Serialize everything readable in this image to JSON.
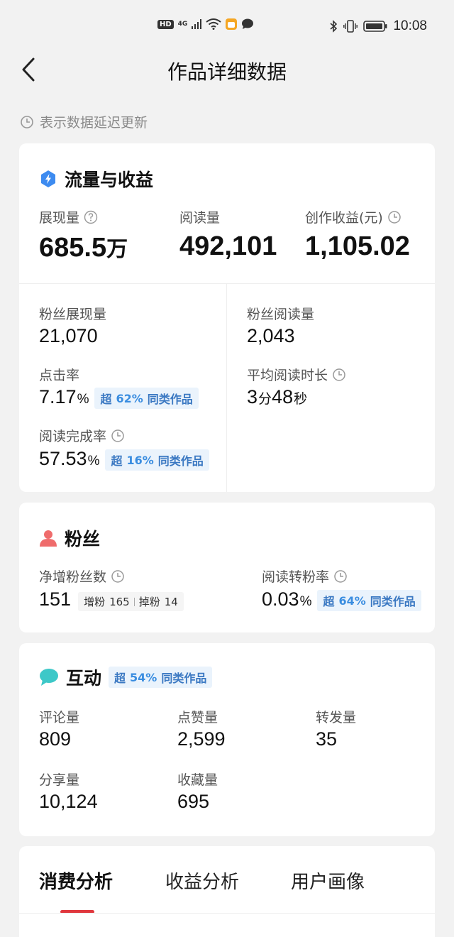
{
  "status_bar": {
    "hd": "HD",
    "network": "4G",
    "time": "10:08"
  },
  "header": {
    "title": "作品详细数据"
  },
  "notice": {
    "text": "表示数据延迟更新"
  },
  "traffic": {
    "title": "流量与收益",
    "impressions": {
      "label": "展现量",
      "value": "685.5",
      "unit": "万"
    },
    "reads": {
      "label": "阅读量",
      "value": "492,101"
    },
    "earnings": {
      "label": "创作收益(元)",
      "value": "1,105.02"
    },
    "fan_impressions": {
      "label": "粉丝展现量",
      "value": "21,070"
    },
    "fan_reads": {
      "label": "粉丝阅读量",
      "value": "2,043"
    },
    "ctr": {
      "label": "点击率",
      "value": "7.17",
      "unit": "%",
      "badge_prefix": "超",
      "badge_pct": "62%",
      "badge_suffix": "同类作品"
    },
    "avg_read_time": {
      "label": "平均阅读时长",
      "minutes": "3",
      "min_unit": "分",
      "seconds": "48",
      "sec_unit": "秒"
    },
    "completion": {
      "label": "阅读完成率",
      "value": "57.53",
      "unit": "%",
      "badge_prefix": "超",
      "badge_pct": "16%",
      "badge_suffix": "同类作品"
    }
  },
  "fans": {
    "title": "粉丝",
    "net_gain": {
      "label": "净增粉丝数",
      "value": "151",
      "gain_label": "增粉",
      "gain": "165",
      "loss_label": "掉粉",
      "loss": "14"
    },
    "conversion": {
      "label": "阅读转粉率",
      "value": "0.03",
      "unit": "%",
      "badge_prefix": "超",
      "badge_pct": "64%",
      "badge_suffix": "同类作品"
    }
  },
  "interaction": {
    "title": "互动",
    "badge_prefix": "超",
    "badge_pct": "54%",
    "badge_suffix": "同类作品",
    "comments": {
      "label": "评论量",
      "value": "809"
    },
    "likes": {
      "label": "点赞量",
      "value": "2,599"
    },
    "reposts": {
      "label": "转发量",
      "value": "35"
    },
    "shares": {
      "label": "分享量",
      "value": "10,124"
    },
    "favorites": {
      "label": "收藏量",
      "value": "695"
    }
  },
  "tabs": [
    {
      "label": "消费分析"
    },
    {
      "label": "收益分析"
    },
    {
      "label": "用户画像"
    }
  ],
  "colors": {
    "accent_red": "#e0383e",
    "badge_blue": "#3a78c2",
    "traffic_icon": "#3d8bf0",
    "fans_icon": "#ef6c6c",
    "interaction_icon": "#3dc8c8"
  }
}
